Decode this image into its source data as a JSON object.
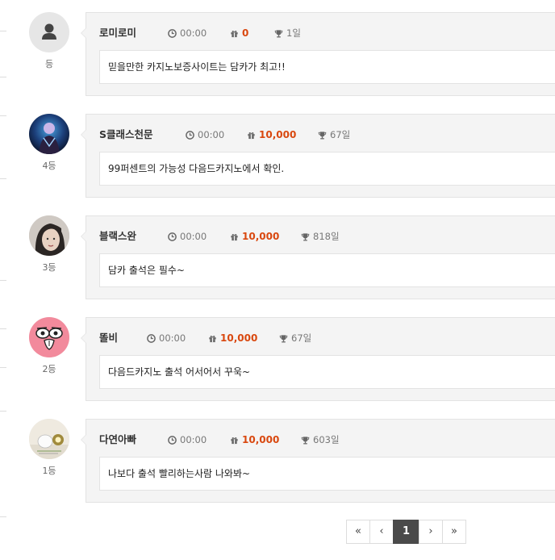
{
  "entries": [
    {
      "nickname": "로미로미",
      "time": "00:00",
      "points": "0",
      "streak": "1일",
      "rank": "등",
      "comment": "믿을만한 카지노보증사이트는 담카가 최고!!",
      "avatar": "default-user"
    },
    {
      "nickname": "S클래스천문",
      "time": "00:00",
      "points": "10,000",
      "streak": "67일",
      "rank": "4등",
      "comment": "99퍼센트의 가능성 다음드카지노에서 확인.",
      "avatar": "photo"
    },
    {
      "nickname": "블랙스완",
      "time": "00:00",
      "points": "10,000",
      "streak": "818일",
      "rank": "3등",
      "comment": "담카 출석은 필수~",
      "avatar": "photo"
    },
    {
      "nickname": "똘비",
      "time": "00:00",
      "points": "10,000",
      "streak": "67일",
      "rank": "2등",
      "comment": "다음드카지노 출석 어서어서 꾸욱~",
      "avatar": "pink-character"
    },
    {
      "nickname": "다연아빠",
      "time": "00:00",
      "points": "10,000",
      "streak": "603일",
      "rank": "1등",
      "comment": "나보다 출석 빨리하는사람 나와봐~",
      "avatar": "photo"
    }
  ],
  "pagination": {
    "first": "«",
    "prev": "‹",
    "current": "1",
    "next": "›",
    "last": "»"
  },
  "colors": {
    "points": "#d9480f",
    "active_page": "#4a4a4a",
    "card_bg": "#f4f4f4"
  }
}
